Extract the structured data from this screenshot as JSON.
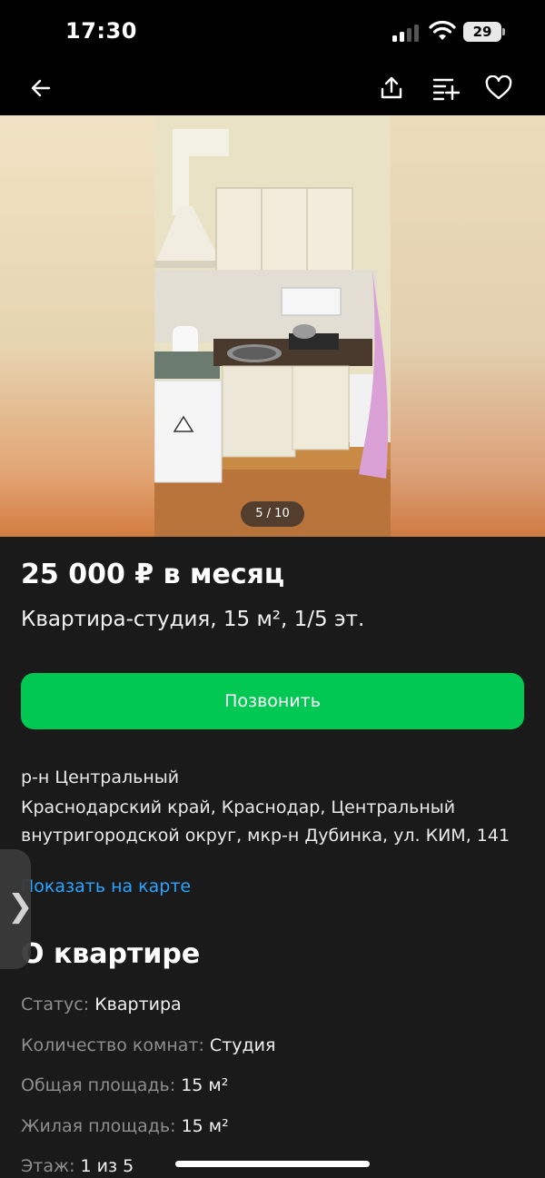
{
  "status_bar": {
    "time": "17:30",
    "battery": "29"
  },
  "top_bar": {
    "back_icon": "arrow-left-icon",
    "share_icon": "share-icon",
    "compare_icon": "compare-list-icon",
    "favorite_icon": "heart-icon"
  },
  "gallery": {
    "counter": "5 / 10",
    "current": 5,
    "total": 10
  },
  "listing": {
    "price": "25 000 ₽ в месяц",
    "subtitle": "Квартира-студия, 15 м², 1/5 эт.",
    "call_label": "Позвонить",
    "district": "р-н Центральный",
    "address": "Краснодарский край, Краснодар, Центральный внутригородской округ, мкр-н Дубинка, ул. КИМ, 141",
    "map_link": "Показать на карте"
  },
  "about": {
    "title": "О квартире",
    "props": [
      {
        "key": "Статус:",
        "value": "Квартира"
      },
      {
        "key": "Количество комнат:",
        "value": "Студия"
      },
      {
        "key": "Общая площадь:",
        "value": "15 м²"
      },
      {
        "key": "Жилая площадь:",
        "value": "15 м²"
      },
      {
        "key": "Этаж:",
        "value": "1 из 5"
      }
    ]
  },
  "colors": {
    "accent_green": "#00c853",
    "link_blue": "#2aa4ff",
    "background": "#1a1a1a"
  }
}
